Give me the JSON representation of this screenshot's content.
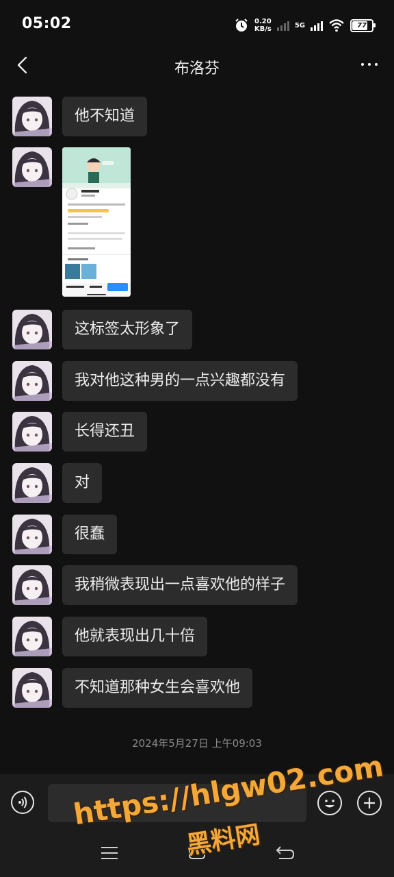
{
  "status_bar": {
    "time": "05:02",
    "speed_value": "0.20",
    "speed_unit": "KB/s",
    "network": "5G",
    "battery": "77"
  },
  "header": {
    "title": "布洛芬",
    "back_icon": "chevron-left-icon",
    "more_icon": "more-dots-icon"
  },
  "messages": [
    {
      "type": "text",
      "text": "他不知道"
    },
    {
      "type": "image"
    },
    {
      "type": "text",
      "text": "这标签太形象了"
    },
    {
      "type": "text",
      "text": "我对他这种男的一点兴趣都没有"
    },
    {
      "type": "text",
      "text": "长得还丑"
    },
    {
      "type": "text",
      "text": "对"
    },
    {
      "type": "text",
      "text": "很蠢"
    },
    {
      "type": "text",
      "text": "我稍微表现出一点喜欢他的样子"
    },
    {
      "type": "text",
      "text": "他就表现出几十倍"
    },
    {
      "type": "text",
      "text": "不知道那种女生会喜欢他"
    }
  ],
  "timestamp": "2024年5月27日 上午09:03",
  "input_bar": {
    "voice_icon": "voice-icon",
    "emoji_icon": "emoji-icon",
    "plus_icon": "plus-icon",
    "value": ""
  },
  "watermark": {
    "url": "https://hlgw02.com",
    "text": "黑料网"
  }
}
